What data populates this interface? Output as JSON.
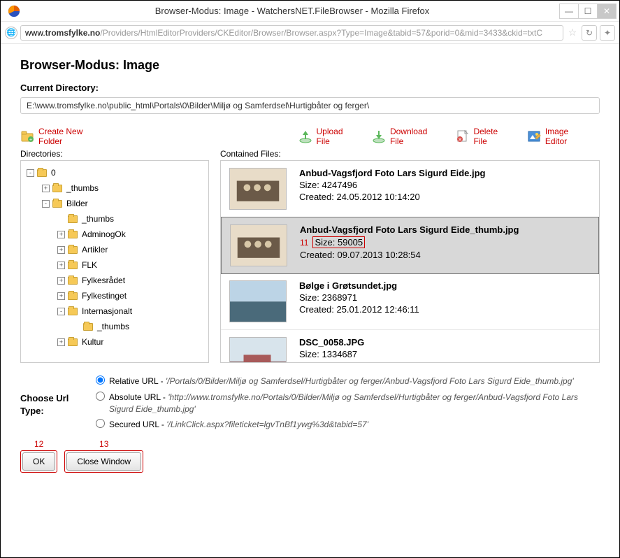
{
  "window": {
    "title": "Browser-Modus: Image - WatchersNET.FileBrowser - Mozilla Firefox"
  },
  "address": {
    "prefix": "www.",
    "domain": "tromsfylke.no",
    "path": "/Providers/HtmlEditorProviders/CKEditor/Browser/Browser.aspx?Type=Image&tabid=57&porid=0&mid=3433&ckid=txtC"
  },
  "page": {
    "mode_title": "Browser-Modus: Image",
    "current_dir_label": "Current Directory:",
    "current_dir_value": "E:\\www.tromsfylke.no\\public_html\\Portals\\0\\Bilder\\Miljø og Samferdsel\\Hurtigbåter og ferger\\"
  },
  "toolbar": {
    "create_folder": "Create New Folder",
    "upload": "Upload File",
    "download": "Download File",
    "delete": "Delete File",
    "editor": "Image Editor"
  },
  "labels": {
    "directories": "Directories:",
    "contained": "Contained Files:",
    "choose_url": "Choose Url Type:"
  },
  "tree": {
    "root": "0",
    "items": [
      {
        "name": "_thumbs",
        "indent": 1,
        "exp": "+"
      },
      {
        "name": "Bilder",
        "indent": 1,
        "exp": "-"
      },
      {
        "name": "_thumbs",
        "indent": 2,
        "exp": ""
      },
      {
        "name": "AdminogOk",
        "indent": 2,
        "exp": "+"
      },
      {
        "name": "Artikler",
        "indent": 2,
        "exp": "+"
      },
      {
        "name": "FLK",
        "indent": 2,
        "exp": "+"
      },
      {
        "name": "Fylkesrådet",
        "indent": 2,
        "exp": "+"
      },
      {
        "name": "Fylkestinget",
        "indent": 2,
        "exp": "+"
      },
      {
        "name": "Internasjonalt",
        "indent": 2,
        "exp": "-"
      },
      {
        "name": "_thumbs",
        "indent": 3,
        "exp": ""
      },
      {
        "name": "Kultur",
        "indent": 2,
        "exp": "+"
      }
    ]
  },
  "files": [
    {
      "name": "Anbud-Vagsfjord Foto Lars Sigurd Eide.jpg",
      "size": "Size: 4247496",
      "created": "Created: 24.05.2012 10:14:20",
      "selected": false
    },
    {
      "name": "Anbud-Vagsfjord Foto Lars Sigurd Eide_thumb.jpg",
      "size": "Size: 59005",
      "created": "Created: 09.07.2013 10:28:54",
      "selected": true,
      "marker": "11"
    },
    {
      "name": "Bølge i Grøtsundet.jpg",
      "size": "Size: 2368971",
      "created": "Created: 25.01.2012 12:46:11",
      "selected": false
    },
    {
      "name": "DSC_0058.JPG",
      "size": "Size: 1334687",
      "created": "",
      "selected": false
    }
  ],
  "url_options": {
    "relative": {
      "label": "Relative URL",
      "value": "'/Portals/0/Bilder/Miljø og Samferdsel/Hurtigbåter og ferger/Anbud-Vagsfjord Foto Lars Sigurd Eide_thumb.jpg'"
    },
    "absolute": {
      "label": "Absolute URL",
      "value": "'http://www.tromsfylke.no/Portals/0/Bilder/Miljø og Samferdsel/Hurtigbåter og ferger/Anbud-Vagsfjord Foto Lars Sigurd Eide_thumb.jpg'"
    },
    "secured": {
      "label": "Secured URL",
      "value": "'/LinkClick.aspx?fileticket=lgvTnBf1ywg%3d&tabid=57'"
    }
  },
  "buttons": {
    "ok": "OK",
    "close": "Close Window",
    "marker_ok": "12",
    "marker_close": "13"
  }
}
